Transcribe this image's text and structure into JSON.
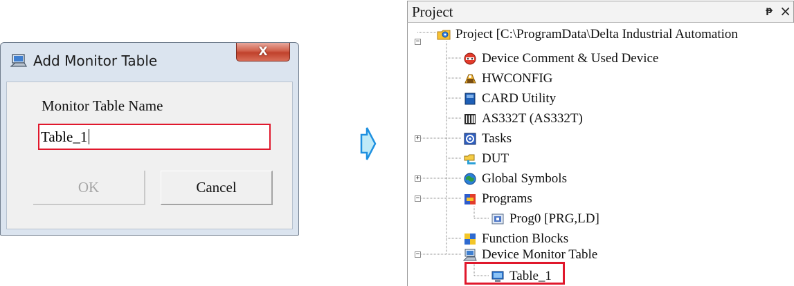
{
  "dialog": {
    "title": "Add Monitor Table",
    "close_label": "X",
    "field_label": "Monitor Table Name",
    "field_value": "Table_1",
    "ok_label": "OK",
    "cancel_label": "Cancel"
  },
  "panel": {
    "title": "Project",
    "pin_label": "ᵽ",
    "close_label": "×"
  },
  "tree": {
    "root": "Project [C:\\ProgramData\\Delta Industrial Automation",
    "items": [
      {
        "label": "Device Comment & Used Device",
        "icon": "device-comment-icon"
      },
      {
        "label": "HWCONFIG",
        "icon": "hwconfig-icon"
      },
      {
        "label": "CARD Utility",
        "icon": "card-utility-icon"
      },
      {
        "label": "AS332T  (AS332T)",
        "icon": "plc-icon"
      },
      {
        "label": "Tasks",
        "icon": "tasks-icon"
      },
      {
        "label": "DUT",
        "icon": "dut-icon"
      },
      {
        "label": "Global Symbols",
        "icon": "global-symbols-icon"
      },
      {
        "label": "Programs",
        "icon": "programs-icon"
      },
      {
        "label": "Prog0 [PRG,LD]",
        "icon": "program-icon"
      },
      {
        "label": "Function Blocks",
        "icon": "function-blocks-icon"
      },
      {
        "label": "Device Monitor Table",
        "icon": "monitor-table-icon"
      },
      {
        "label": "Table_1",
        "icon": "monitor-icon"
      }
    ]
  },
  "colors": {
    "highlight": "#e0182c",
    "arrow_fill": "#bfeaf7",
    "arrow_stroke": "#1e90e0"
  }
}
